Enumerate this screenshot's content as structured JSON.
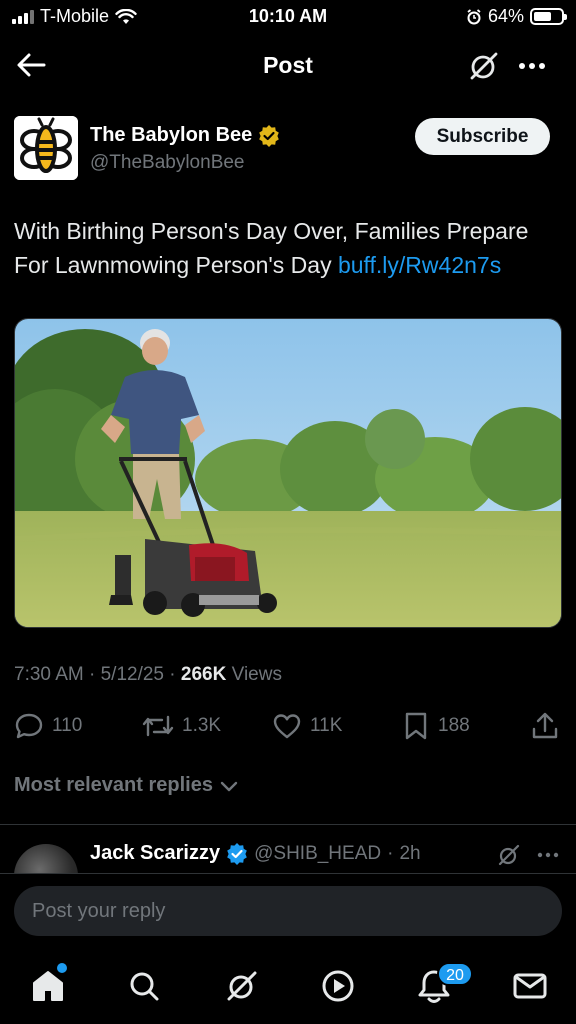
{
  "status_bar": {
    "carrier": "T-Mobile",
    "time": "10:10 AM",
    "battery": "64%",
    "battery_level": 0.64,
    "icons": [
      "signal-icon",
      "wifi-icon",
      "alarm-icon",
      "battery-icon"
    ]
  },
  "nav": {
    "title": "Post",
    "icons": [
      "back-arrow-icon",
      "grok-icon",
      "more-icon"
    ]
  },
  "post": {
    "author_name": "The Babylon Bee",
    "author_handle": "@TheBabylonBee",
    "verified_color": "#e2b719",
    "subscribe_label": "Subscribe",
    "text": "With Birthing Person's Day Over, Families Prepare For Lawnmowing Person's Day",
    "link": "buff.ly/Rw42n7s",
    "time": "7:30 AM",
    "date": "5/12/25",
    "views_count": "266K",
    "views_label": "Views",
    "media_icon": "man-mowing-lawn-photo"
  },
  "actions": {
    "replies": "110",
    "reposts": "1.3K",
    "likes": "11K",
    "bookmarks": "188",
    "icons": [
      "reply-icon",
      "repost-icon",
      "like-icon",
      "bookmark-icon",
      "share-icon"
    ]
  },
  "replies_sort": "Most relevant replies",
  "reply": {
    "name": "Jack Scarizzy",
    "handle": "@SHIB_HEAD",
    "time": "2h",
    "verified_color": "#1d9bf0"
  },
  "composer": {
    "placeholder": "Post your reply"
  },
  "tab_bar": {
    "notifications_badge": "20",
    "icons": [
      "home-icon",
      "search-icon",
      "grok-icon",
      "video-icon",
      "notifications-icon",
      "messages-icon"
    ]
  },
  "colors": {
    "accent": "#1d9bf0",
    "background": "#000000",
    "muted_text": "#71767b"
  }
}
